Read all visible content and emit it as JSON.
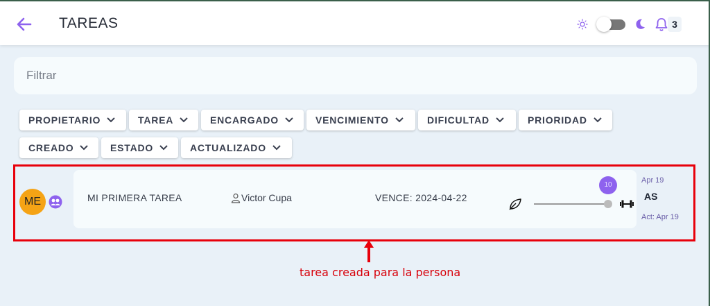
{
  "header": {
    "title": "TAREAS",
    "notification_count": "3",
    "accent_color": "#8e62ee"
  },
  "filter": {
    "placeholder": "Filtrar",
    "value": ""
  },
  "sort_buttons": [
    "PROPIETARIO",
    "TAREA",
    "ENCARGADO",
    "VENCIMIENTO",
    "DIFICULTAD",
    "PRIORIDAD",
    "CREADO",
    "ESTADO",
    "ACTUALIZADO"
  ],
  "task": {
    "owner_initials": "ME",
    "name": "MI PRIMERA TAREA",
    "assignee": "Victor Cupa",
    "due": "VENCE: 2024-04-22",
    "score": "10",
    "created": "Apr 19",
    "assignee_initials": "AS",
    "updated": "Act: Apr 19",
    "difficulty_level": 1.0,
    "owner_color": "#f5a315"
  },
  "annotation": {
    "text": "tarea creada para la persona",
    "color": "#e8000b"
  },
  "icons": [
    "back-arrow-icon",
    "sun-icon",
    "moon-icon",
    "bell-icon",
    "chevron-down-icon",
    "group-icon",
    "person-icon",
    "leaf-icon",
    "dumbbell-icon"
  ]
}
